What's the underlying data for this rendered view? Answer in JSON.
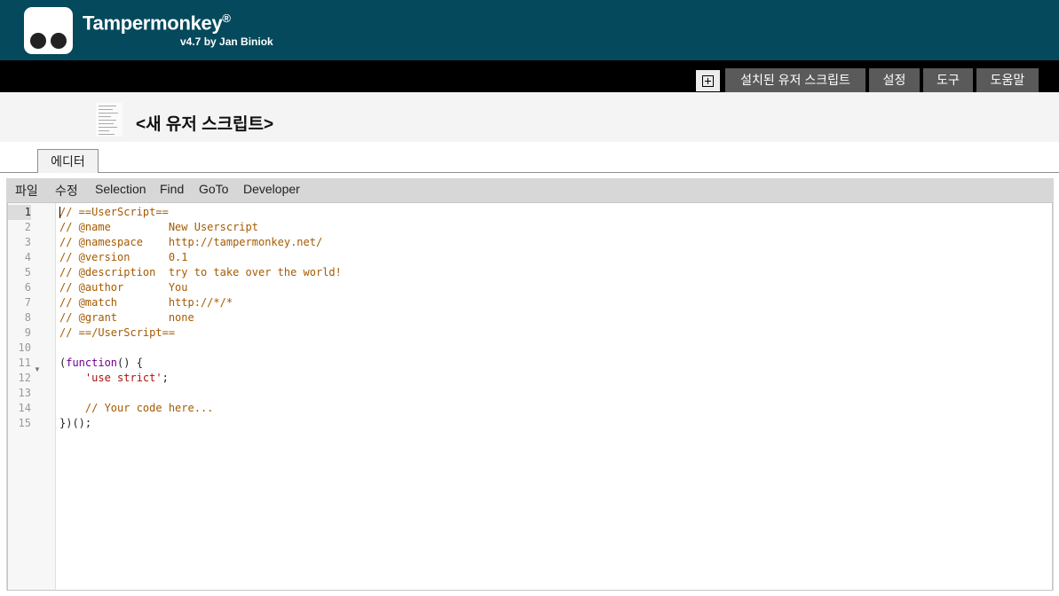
{
  "header": {
    "title": "Tampermonkey",
    "title_mark": "®",
    "version": "v4.7 by Jan Biniok"
  },
  "nav": {
    "tabs": [
      {
        "label": "설치된 유저 스크립트"
      },
      {
        "label": "설정"
      },
      {
        "label": "도구"
      },
      {
        "label": "도움말"
      }
    ]
  },
  "script": {
    "name": "<새 유저 스크립트>"
  },
  "tabs": {
    "editor": "에디터"
  },
  "menu": {
    "items": [
      "파일",
      "수정",
      "Selection",
      "Find",
      "GoTo",
      "Developer"
    ]
  },
  "editor": {
    "active_line": 1,
    "line_numbers": [
      "1",
      "2",
      "3",
      "4",
      "5",
      "6",
      "7",
      "8",
      "9",
      "10",
      "11",
      "12",
      "13",
      "14",
      "15"
    ],
    "lines": [
      "// ==UserScript==",
      "// @name         New Userscript",
      "// @namespace    http://tampermonkey.net/",
      "// @version      0.1",
      "// @description  try to take over the world!",
      "// @author       You",
      "// @match        http://*/*",
      "// @grant        none",
      "// ==/UserScript==",
      "",
      "(function() {",
      "    'use strict';",
      "",
      "    // Your code here...",
      "})();"
    ],
    "line11_parts": {
      "open": "(",
      "keyword": "function",
      "rest": "() {"
    },
    "line12_parts": {
      "indent": "    ",
      "string": "'use strict'",
      "semi": ";"
    }
  },
  "colors": {
    "header_bg": "#04495c",
    "comment": "#a55a00",
    "keyword": "#700090",
    "string": "#aa1111"
  }
}
